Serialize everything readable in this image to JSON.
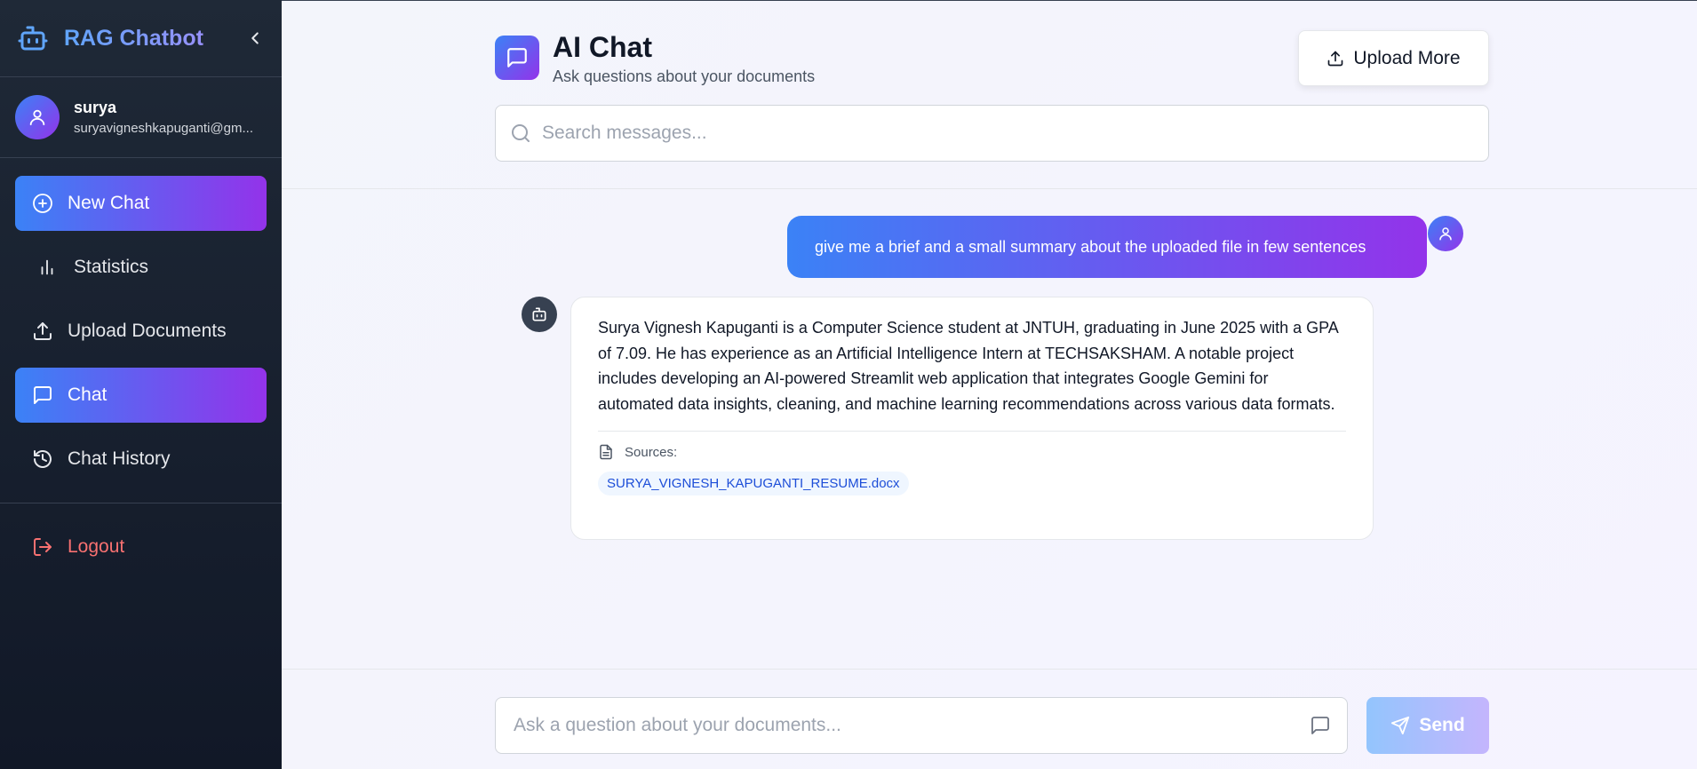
{
  "sidebar": {
    "brand": "RAG Chatbot",
    "user": {
      "name": "surya",
      "email": "suryavigneshkapuganti@gm..."
    },
    "nav": {
      "new_chat": "New Chat",
      "statistics": "Statistics",
      "upload_documents": "Upload Documents",
      "chat": "Chat",
      "chat_history": "Chat History"
    },
    "logout": "Logout"
  },
  "header": {
    "title": "AI Chat",
    "subtitle": "Ask questions about your documents",
    "upload_more": "Upload More"
  },
  "search": {
    "placeholder": "Search messages..."
  },
  "messages": {
    "user": "give me a brief and a small summary about the uploaded file in few sentences",
    "bot": "Surya Vignesh Kapuganti is a Computer Science student at JNTUH, graduating in June 2025 with a GPA of 7.09. He has experience as an Artificial Intelligence Intern at TECHSAKSHAM. A notable project includes developing an AI-powered Streamlit web application that integrates Google Gemini for automated data insights, cleaning, and machine learning recommendations across various data formats.",
    "sources_label": "Sources:",
    "source_file": "SURYA_VIGNESH_KAPUGANTI_RESUME.docx"
  },
  "composer": {
    "placeholder": "Ask a question about your documents...",
    "send": "Send"
  },
  "colors": {
    "accent_start": "#3b82f6",
    "accent_end": "#9333ea",
    "sidebar_bg": "#1f2937",
    "logout": "#f87171"
  },
  "icons": {
    "brand": "bot-icon",
    "collapse": "chevron-left-icon",
    "new_chat": "plus-circle-icon",
    "statistics": "bar-chart-icon",
    "upload": "upload-icon",
    "chat": "message-square-icon",
    "history": "history-icon",
    "logout": "logout-icon",
    "search": "search-icon",
    "send": "send-icon",
    "file": "file-text-icon"
  }
}
